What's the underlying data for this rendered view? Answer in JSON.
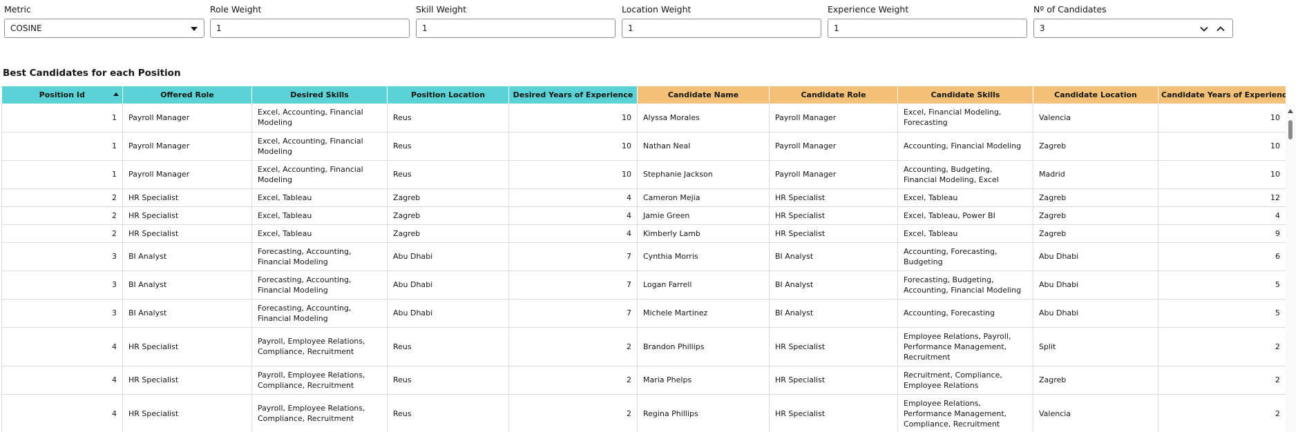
{
  "filters": {
    "metric": {
      "label": "Metric",
      "value": "COSINE"
    },
    "role_weight": {
      "label": "Role Weight",
      "value": "1"
    },
    "skill_weight": {
      "label": "Skill Weight",
      "value": "1"
    },
    "location_weight": {
      "label": "Location Weight",
      "value": "1"
    },
    "experience_weight": {
      "label": "Experience Weight",
      "value": "1"
    },
    "num_candidates": {
      "label": "Nº of Candidates",
      "value": "3"
    }
  },
  "section_title": "Best Candidates for each Position",
  "colors": {
    "position_header": "#5bd3d6",
    "candidate_header": "#f3c078"
  },
  "table": {
    "columns": [
      "Position Id",
      "Offered Role",
      "Desired Skills",
      "Position Location",
      "Desired Years of Experience",
      "Candidate Name",
      "Candidate Role",
      "Candidate Skills",
      "Candidate Location",
      "Candidate Years of Experience"
    ],
    "rows": [
      [
        "1",
        "Payroll Manager",
        "Excel, Accounting, Financial Modeling",
        "Reus",
        "10",
        "Alyssa Morales",
        "Payroll Manager",
        "Excel, Financial Modeling, Forecasting",
        "Valencia",
        "10"
      ],
      [
        "1",
        "Payroll Manager",
        "Excel, Accounting, Financial Modeling",
        "Reus",
        "10",
        "Nathan Neal",
        "Payroll Manager",
        "Accounting, Financial Modeling",
        "Zagreb",
        "10"
      ],
      [
        "1",
        "Payroll Manager",
        "Excel, Accounting, Financial Modeling",
        "Reus",
        "10",
        "Stephanie Jackson",
        "Payroll Manager",
        "Accounting, Budgeting, Financial Modeling, Excel",
        "Madrid",
        "10"
      ],
      [
        "2",
        "HR Specialist",
        "Excel, Tableau",
        "Zagreb",
        "4",
        "Cameron Mejia",
        "HR Specialist",
        "Excel, Tableau",
        "Zagreb",
        "12"
      ],
      [
        "2",
        "HR Specialist",
        "Excel, Tableau",
        "Zagreb",
        "4",
        "Jamie Green",
        "HR Specialist",
        "Excel, Tableau, Power BI",
        "Zagreb",
        "4"
      ],
      [
        "2",
        "HR Specialist",
        "Excel, Tableau",
        "Zagreb",
        "4",
        "Kimberly Lamb",
        "HR Specialist",
        "Excel, Tableau",
        "Zagreb",
        "9"
      ],
      [
        "3",
        "BI Analyst",
        "Forecasting, Accounting, Financial Modeling",
        "Abu Dhabi",
        "7",
        "Cynthia Morris",
        "BI Analyst",
        "Accounting, Forecasting, Budgeting",
        "Abu Dhabi",
        "6"
      ],
      [
        "3",
        "BI Analyst",
        "Forecasting, Accounting, Financial Modeling",
        "Abu Dhabi",
        "7",
        "Logan Farrell",
        "BI Analyst",
        "Forecasting, Budgeting, Accounting, Financial Modeling",
        "Abu Dhabi",
        "5"
      ],
      [
        "3",
        "BI Analyst",
        "Forecasting, Accounting, Financial Modeling",
        "Abu Dhabi",
        "7",
        "Michele Martinez",
        "BI Analyst",
        "Accounting, Forecasting",
        "Abu Dhabi",
        "5"
      ],
      [
        "4",
        "HR Specialist",
        "Payroll, Employee Relations, Compliance, Recruitment",
        "Reus",
        "2",
        "Brandon Phillips",
        "HR Specialist",
        "Employee Relations, Payroll, Performance Management, Recruitment",
        "Split",
        "2"
      ],
      [
        "4",
        "HR Specialist",
        "Payroll, Employee Relations, Compliance, Recruitment",
        "Reus",
        "2",
        "Maria Phelps",
        "HR Specialist",
        "Recruitment, Compliance, Employee Relations",
        "Zagreb",
        "2"
      ],
      [
        "4",
        "HR Specialist",
        "Payroll, Employee Relations, Compliance, Recruitment",
        "Reus",
        "2",
        "Regina Phillips",
        "HR Specialist",
        "Employee Relations, Performance Management, Compliance, Recruitment",
        "Valencia",
        "2"
      ]
    ]
  }
}
